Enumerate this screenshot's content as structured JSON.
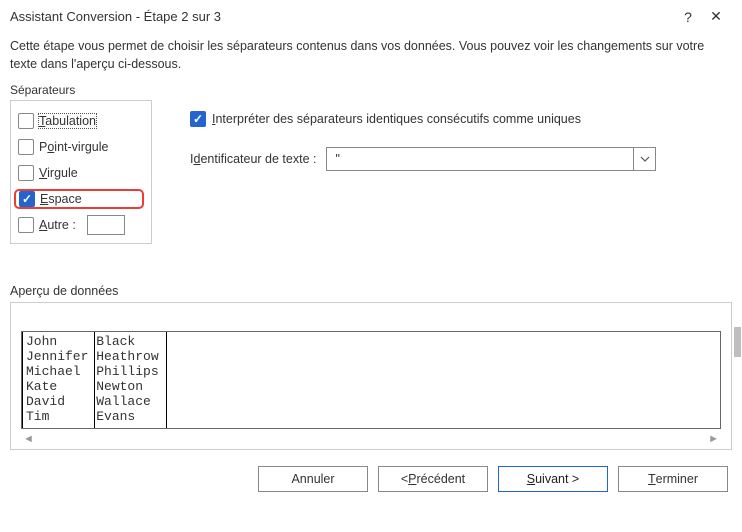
{
  "titlebar": {
    "title": "Assistant Conversion - Étape 2 sur 3",
    "help": "?",
    "close": "✕"
  },
  "instructions": "Cette étape vous permet de choisir les séparateurs contenus dans vos données. Vous pouvez voir les changements sur votre texte dans l'aperçu ci-dessous.",
  "separators": {
    "legend": "Séparateurs",
    "tabulation": "Tabulation",
    "pointvirgule": "Point-virgule",
    "virgule": "Virgule",
    "espace": "Espace",
    "autre": "Autre :",
    "autre_value": ""
  },
  "options": {
    "treat_consecutive": "Interpréter des séparateurs identiques consécutifs comme uniques",
    "text_qualifier_label": "Identificateur de texte :",
    "text_qualifier_value": "\""
  },
  "preview": {
    "legend": "Aperçu de données",
    "col1": [
      "John",
      "Jennifer",
      "Michael",
      "Kate",
      "David",
      "Tim"
    ],
    "col2": [
      "Black",
      "Heathrow",
      "Phillips",
      "Newton",
      "Wallace",
      "Evans"
    ]
  },
  "buttons": {
    "cancel": "Annuler",
    "back": "< Précédent",
    "next": "Suivant >",
    "finish": "Terminer"
  },
  "underline": {
    "tab": "T",
    "pv": "o",
    "vir": "V",
    "esp": "E",
    "aut": "A",
    "inter": "I",
    "id": "d",
    "prec": "P",
    "suiv": "S",
    "term": "T"
  }
}
